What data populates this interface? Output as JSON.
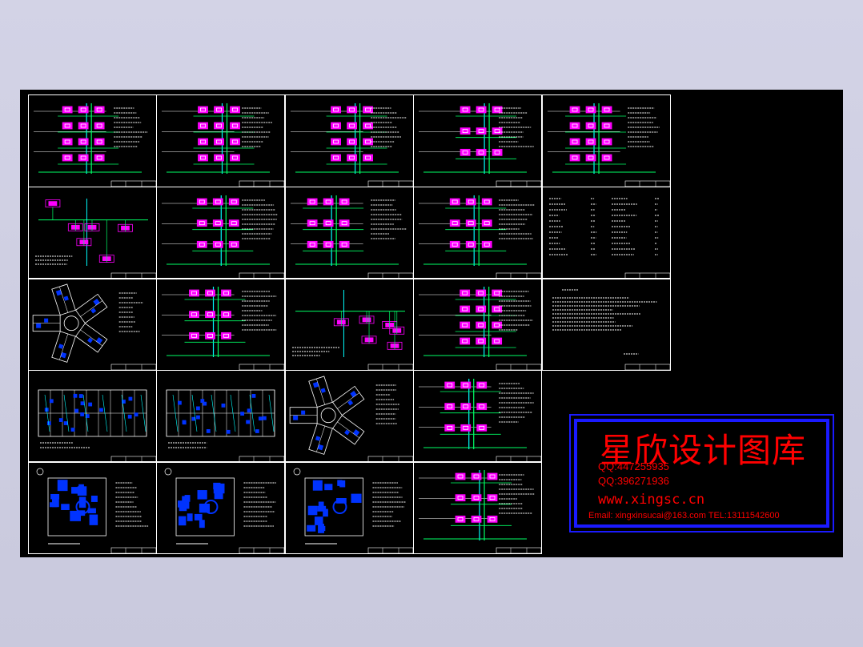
{
  "watermark": {
    "title": "星欣设计图库",
    "qq1": "QQ:447255935",
    "qq2": "QQ:396271936",
    "website": "www.xingsc.cn",
    "email_line": "Email: xingxinsucai@163.com  TEL:13111542600"
  },
  "colors": {
    "background": "#000000",
    "frame": "#ffffff",
    "line_green": "#00ff66",
    "line_cyan": "#00ffff",
    "block_magenta": "#ff00ff",
    "plan_blue": "#0033ff",
    "watermark_red": "#ff0000",
    "watermark_border": "#1a1aff"
  },
  "sheets": [
    {
      "id": "r1c1",
      "kind": "riser"
    },
    {
      "id": "r1c2",
      "kind": "riser"
    },
    {
      "id": "r1c3",
      "kind": "riser"
    },
    {
      "id": "r1c4",
      "kind": "riser"
    },
    {
      "id": "r1c5",
      "kind": "riser"
    },
    {
      "id": "r2c1",
      "kind": "schematic"
    },
    {
      "id": "r2c2",
      "kind": "riser"
    },
    {
      "id": "r2c3",
      "kind": "riser"
    },
    {
      "id": "r2c4",
      "kind": "riser"
    },
    {
      "id": "r2c5",
      "kind": "table"
    },
    {
      "id": "r3c1",
      "kind": "radial-plan"
    },
    {
      "id": "r3c2",
      "kind": "riser"
    },
    {
      "id": "r3c3",
      "kind": "schematic"
    },
    {
      "id": "r3c4",
      "kind": "riser"
    },
    {
      "id": "r3c5",
      "kind": "notes"
    },
    {
      "id": "r4c1",
      "kind": "grid-plan"
    },
    {
      "id": "r4c2",
      "kind": "grid-plan"
    },
    {
      "id": "r4c3",
      "kind": "radial-plan"
    },
    {
      "id": "r4c4",
      "kind": "riser"
    },
    {
      "id": "r5c1",
      "kind": "unit-plan"
    },
    {
      "id": "r5c2",
      "kind": "unit-plan"
    },
    {
      "id": "r5c3",
      "kind": "unit-plan"
    },
    {
      "id": "r5c4",
      "kind": "riser"
    }
  ]
}
